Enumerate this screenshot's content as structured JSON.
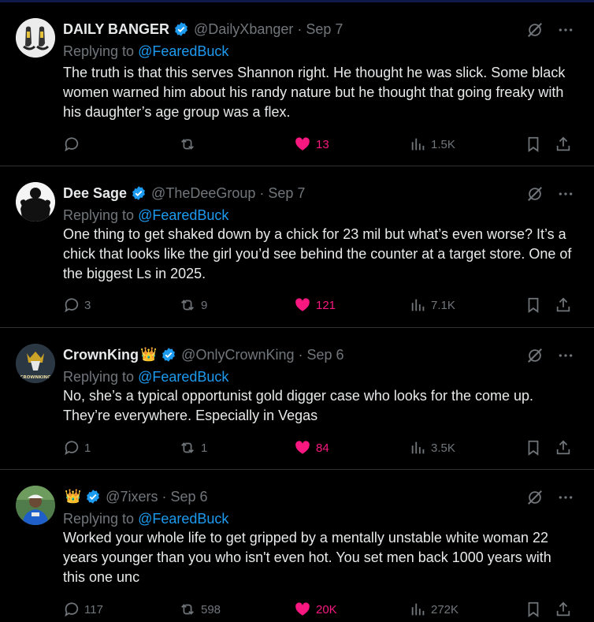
{
  "replies": [
    {
      "name": "DAILY BANGER",
      "crown": "",
      "handle": "@DailyXbanger",
      "separator": "·",
      "date": "Sep 7",
      "replying_prefix": "Replying to",
      "replying_to": "@FearedBuck",
      "text": "The truth is that this serves Shannon right. He thought he was slick. Some black women warned him about his randy nature but he thought that going freaky with his daughter’s age group was a flex.",
      "replies": "",
      "reposts": "",
      "likes": "13",
      "views": "1.5K",
      "avatar": "sneakers-avatar"
    },
    {
      "name": "Dee Sage",
      "crown": "",
      "handle": "@TheDeeGroup",
      "separator": "·",
      "date": "Sep 7",
      "replying_prefix": "Replying to",
      "replying_to": "@FearedBuck",
      "text": "One thing to get shaked down by a chick for 23 mil but what’s even worse? It’s a chick that looks like the girl you’d see behind the counter at a target store. One of the biggest Ls in 2025.",
      "replies": "3",
      "reposts": "9",
      "likes": "121",
      "views": "7.1K",
      "avatar": "silhouette-avatar"
    },
    {
      "name": "CrownKing",
      "crown": "👑",
      "handle": "@OnlyCrownKing",
      "separator": "·",
      "date": "Sep 6",
      "replying_prefix": "Replying to",
      "replying_to": "@FearedBuck",
      "text": "No, she’s a typical opportunist gold digger case who looks for the come up. They’re everywhere. Especially in Vegas",
      "replies": "1",
      "reposts": "1",
      "likes": "84",
      "views": "3.5K",
      "avatar": "crownking-avatar",
      "avatar_text": "CROWNKING"
    },
    {
      "name": "",
      "crown": "👑",
      "handle": "@7ixers",
      "separator": "·",
      "date": "Sep 6",
      "replying_prefix": "Replying to",
      "replying_to": "@FearedBuck",
      "text": "Worked your whole life to get gripped by a mentally unstable white woman 22 years younger than you who isn't even hot. You set men back 1000 years with this one unc",
      "replies": "117",
      "reposts": "598",
      "likes": "20K",
      "views": "272K",
      "avatar": "person-avatar"
    }
  ],
  "colors": {
    "background": "#000000",
    "text": "#e7e9ea",
    "muted": "#71767b",
    "link": "#1d9bf0",
    "like": "#f91880",
    "verified": "#1d9bf0",
    "divider": "#2f3336"
  }
}
